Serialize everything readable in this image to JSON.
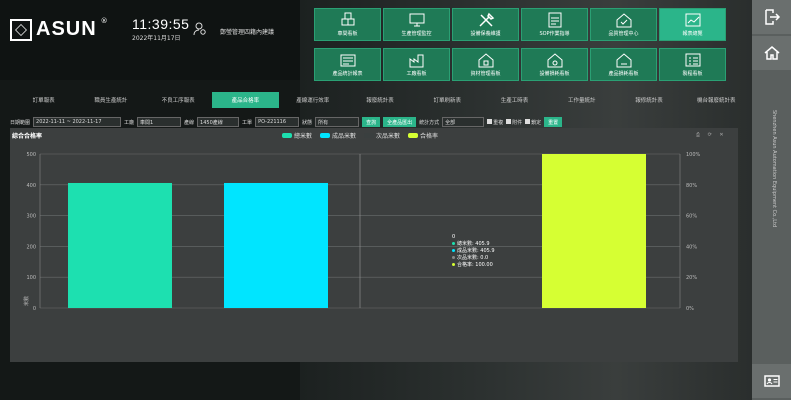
{
  "header": {
    "brand": "ASUN",
    "time": "11:39:55",
    "date": "2022年11月17日",
    "user": "鄭瑩管理四籍內建議"
  },
  "tiles": [
    {
      "label": "車間看板",
      "icon": "boxes-icon"
    },
    {
      "label": "生產管理監控",
      "icon": "monitor-icon"
    },
    {
      "label": "設備保養維護",
      "icon": "tools-icon"
    },
    {
      "label": "SOP作業指導",
      "icon": "sop-icon"
    },
    {
      "label": "品質管理中心",
      "icon": "quality-home-icon"
    },
    {
      "label": "報表總覽",
      "icon": "chart-icon",
      "active": true
    },
    {
      "label": "產品統計報表",
      "icon": "product-icon"
    },
    {
      "label": "工廠看板",
      "icon": "factory-icon"
    },
    {
      "label": "資材管理看板",
      "icon": "material-home-icon"
    },
    {
      "label": "設備損耗看板",
      "icon": "equipment-home-icon"
    },
    {
      "label": "產品損耗看板",
      "icon": "loss-home-icon"
    },
    {
      "label": "製程看板",
      "icon": "process-icon"
    }
  ],
  "tabs": [
    "訂單報表",
    "職員生產統計",
    "不良工序報表",
    "產品合格率",
    "產線運行效率",
    "報廢統計表",
    "訂單刷新表",
    "生產工時表",
    "工作量統計",
    "報修統計表",
    "機台報廢統計表"
  ],
  "filters": {
    "date_label": "日期範圍",
    "date_value": "2022-11-11 ~ 2022-11-17",
    "workshop_label": "工廠",
    "workshop_value": "車間1",
    "line_label": "產線",
    "line_value": "1450產線",
    "process_label": "工單",
    "process_value": "PO-221116",
    "type_label": "狀態",
    "type_value": "所有",
    "search_btn": "查詢",
    "export_btn": "全產品匯出",
    "mode_label": "統計方式",
    "mode_value": "全部",
    "chk1": "重複",
    "chk2": "附件",
    "chk3": "鎖定",
    "reset_btn": "重置"
  },
  "chart_panel": {
    "title": "綜合合格率",
    "tools": "⎙ ⟳ ✕",
    "tooltip_header": "0"
  },
  "chart_data": {
    "type": "bar",
    "categories": [
      "0"
    ],
    "series": [
      {
        "name": "總米數",
        "values": [
          405.9
        ],
        "color": "#1de0b0",
        "axis": "left"
      },
      {
        "name": "成品米數",
        "values": [
          405.9
        ],
        "color": "#00e5ff",
        "axis": "left"
      },
      {
        "name": "次品米數",
        "values": [
          0
        ],
        "color": "#3a3f3f",
        "axis": "left"
      },
      {
        "name": "合格率",
        "values": [
          100
        ],
        "color": "#d6ff33",
        "axis": "right"
      }
    ],
    "ylabel": "米數",
    "y_ticks": [
      "500",
      "400",
      "300",
      "200",
      "100",
      "0"
    ],
    "y_right_ticks": [
      "100%",
      "80%",
      "60%",
      "40%",
      "20%",
      "0%"
    ],
    "ylim": [
      0,
      500
    ],
    "y2lim": [
      0,
      100
    ],
    "grid": true,
    "legend": "top-center",
    "tooltip": [
      "總米數: 405.9",
      "成品米數: 405.9",
      "次品米數: 0.0",
      "合格率: 100.00"
    ]
  },
  "rightbar": {
    "vertical_text": "Shenzhen Asun Automation Equipment Co.,Ltd"
  },
  "colors": {
    "accent": "#2bb58a",
    "tile": "#1f7a56",
    "bg": "#141817"
  }
}
